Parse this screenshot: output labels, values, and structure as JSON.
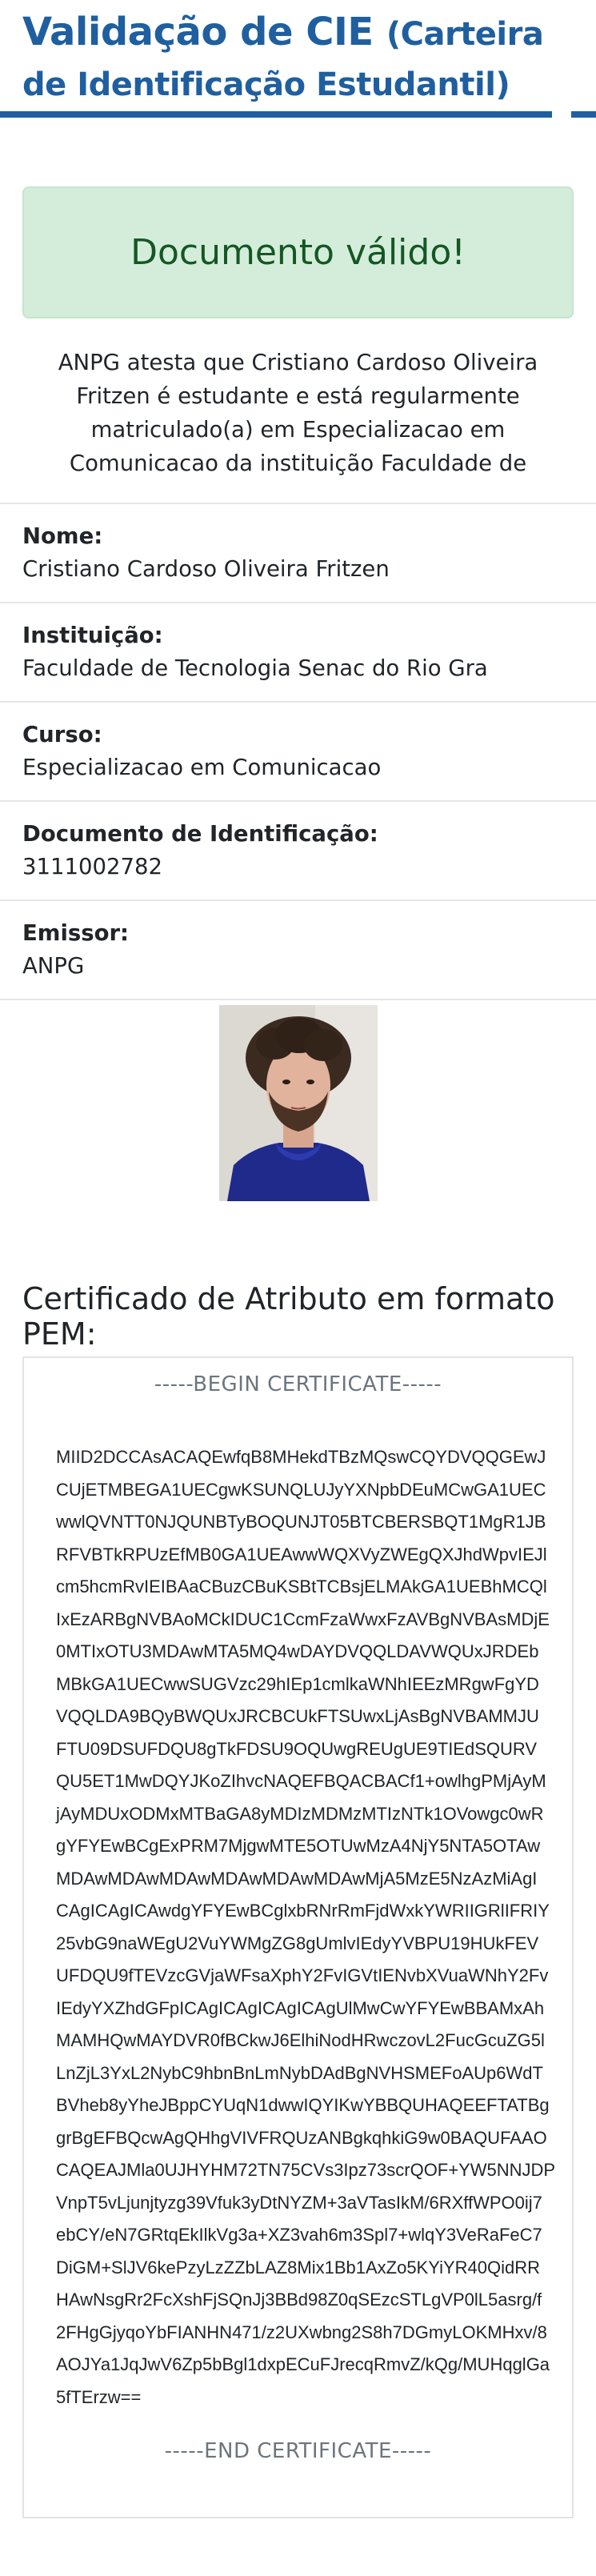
{
  "header": {
    "title_main": "Validação de CIE",
    "title_sub": "(Carteira de Identificação Estudantil)"
  },
  "alert": {
    "text": "Documento válido!"
  },
  "statement": {
    "text": "ANPG atesta que Cristiano Cardoso Oliveira Fritzen é estudante e está regularmente matriculado(a) em Especializacao em Comunicacao da instituição Faculdade de Tecnologia Senac do Rio Gra"
  },
  "fields": [
    {
      "label": "Nome:",
      "value": "Cristiano Cardoso Oliveira Fritzen"
    },
    {
      "label": "Instituição:",
      "value": "Faculdade de Tecnologia Senac do Rio Gra"
    },
    {
      "label": "Curso:",
      "value": "Especializacao em Comunicacao"
    },
    {
      "label": "Documento de Identificação:",
      "value": "3111002782"
    },
    {
      "label": "Emissor:",
      "value": "ANPG"
    }
  ],
  "photo": {
    "alt": "Foto do estudante"
  },
  "certificate": {
    "title": "Certificado de Atributo em formato PEM:",
    "begin": "-----BEGIN CERTIFICATE-----",
    "end": "-----END CERTIFICATE-----",
    "lines": [
      "MIID2DCCAsACAQEwfqB8MHekdTBzMQswCQYDVQQGEwJ",
      "CUjETMBEGA1UECgwKSUNQLUJyYXNpbDEuMCwGA1UEC",
      "wwlQVNTT0NJQUNBTyBOQUNJT05BTCBERSBQT1MgR1JB",
      "RFVBTkRPUzEfMB0GA1UEAwwWQXVyZWEgQXJhdWpvIEJl",
      "cm5hcmRvIEIBAaCBuzCBuKSBtTCBsjELMAkGA1UEBhMCQl",
      "IxEzARBgNVBAoMCkIDUC1CcmFzaWwxFzAVBgNVBAsMDjE",
      "0MTIxOTU3MDAwMTA5MQ4wDAYDVQQLDAVWQUxJRDEb",
      "MBkGA1UECwwSUGVzc29hIEp1cmlkaWNhIEEzMRgwFgYD",
      "VQQLDA9BQyBWQUxJRCBCUkFTSUwxLjAsBgNVBAMMJU",
      "FTU09DSUFDQU8gTkFDSU9OQUwgREUgUE9TIEdSQURV",
      "QU5ET1MwDQYJKoZIhvcNAQEFBQACBACf1+owlhgPMjAyM",
      "jAyMDUxODMxMTBaGA8yMDIzMDMzMTIzNTk1OVowgc0wR",
      "gYFYEwBCgExPRM7MjgwMTE5OTUwMzA4NjY5NTA5OTAw",
      "MDAwMDAwMDAwMDAwMDAwMDAwMjA5MzE5NzAzMiAgI",
      "CAgICAgICAwdgYFYEwBCglxbRNrRmFjdWxkYWRIIGRlIFRIY",
      "25vbG9naWEgU2VuYWMgZG8gUmlvIEdyYVBPU19HUkFEV",
      "UFDQU9fTEVzcGVjaWFsaXphY2FvIGVtIENvbXVuaWNhY2Fv",
      "IEdyYXZhdGFpICAgICAgICAgICAgUlMwCwYFYEwBBAMxAh",
      "MAMHQwMAYDVR0fBCkwJ6ElhiNodHRwczovL2FucGcuZG5l",
      "LnZjL3YxL2NybC9hbnBnLmNybDAdBgNVHSMEFoAUp6WdT",
      "BVheb8yYheJBppCYUqN1dwwIQYIKwYBBQUHAQEEFTATBg",
      "grBgEFBQcwAgQHhgVIVFRQUzANBgkqhkiG9w0BAQUFAAO",
      "CAQEAJMla0UJHYHM72TN75CVs3Ipz73scrQOF+YW5NNJDP",
      "VnpT5vLjunjtyzg39Vfuk3yDtNYZM+3aVTasIkM/6RXffWPO0ij7",
      "ebCY/eN7GRtqEkIlkVg3a+XZ3vah6m3Spl7+wlqY3VeRaFeC7",
      "DiGM+SlJV6kePzyLzZZbLAZ8Mix1Bb1AxZo5KYiYR40QidRR",
      "HAwNsgRr2FcXshFjSQnJj3BBd98Z0qSEzcSTLgVP0lL5asrg/f",
      "2FHgGjyqoYbFIANHN471/z2UXwbng2S8h7DGmyLOKMHxv/8",
      "AOJYa1JqJwV6Zp5bBgl1dxpECuFJrecqRmvZ/kQg/MUHqglGa",
      "5fTErzw=="
    ]
  }
}
